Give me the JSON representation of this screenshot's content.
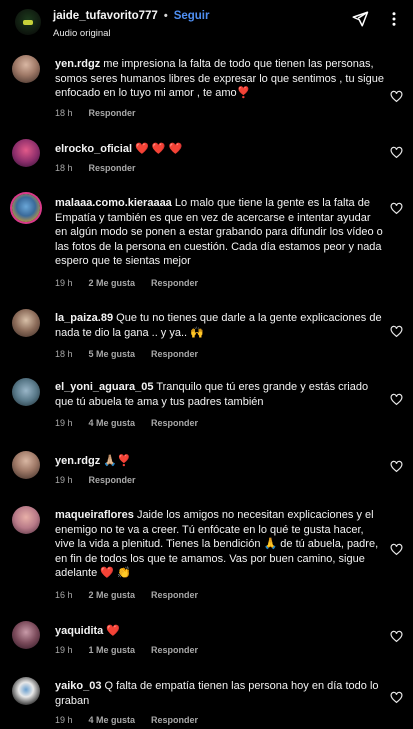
{
  "header": {
    "username": "jaide_tufavorito777",
    "separator": "•",
    "follow_label": "Seguir",
    "audio_label": "Audio original"
  },
  "comments": [
    {
      "username": "yen.rdgz",
      "text": "me impresiona la falta de todo que tienen las personas, somos seres humanos libres de expresar lo que sentimos , tu sigue enfocado en lo tuyo mi amor , te amo❣️",
      "time": "18 h",
      "likes": "",
      "reply": "Responder"
    },
    {
      "username": "elrocko_oficial",
      "text": "❤️ ❤️ ❤️",
      "time": "18 h",
      "likes": "",
      "reply": "Responder"
    },
    {
      "username": "malaaa.como.kieraaaa",
      "text": "Lo malo que tiene la gente es la falta de Empatía y también es que en vez de acercarse e intentar ayudar en algún modo se ponen a estar grabando para difundir los vídeo o las fotos de la persona en cuestión. Cada día estamos peor y nada espero que te sientas mejor",
      "time": "19 h",
      "likes": "2 Me gusta",
      "reply": "Responder"
    },
    {
      "username": "la_paiza.89",
      "text": "Que tu no tienes que darle a la gente explicaciones de nada te dio la gana .. y ya.. 🙌",
      "time": "18 h",
      "likes": "5 Me gusta",
      "reply": "Responder"
    },
    {
      "username": "el_yoni_aguara_05",
      "text": "Tranquilo que tú eres grande y estás criado que tú abuela te ama y tus padres también",
      "time": "19 h",
      "likes": "4 Me gusta",
      "reply": "Responder"
    },
    {
      "username": "yen.rdgz",
      "text": "🙏🏼❣️",
      "time": "19 h",
      "likes": "",
      "reply": "Responder"
    },
    {
      "username": "maqueiraflores",
      "text": "Jaide los amigos no necesitan explicaciones y el enemigo no te va a creer. Tú enfócate en lo qué te gusta hacer, vive la vida a plenitud. Tienes la bendición 🙏 de tú abuela, padre, en fin de todos los que te amamos. Vas por buen camino, sigue adelante ❤️ 👏",
      "time": "16 h",
      "likes": "2 Me gusta",
      "reply": "Responder"
    },
    {
      "username": "yaquidita",
      "text": "❤️",
      "time": "19 h",
      "likes": "1 Me gusta",
      "reply": "Responder"
    },
    {
      "username": "yaiko_03",
      "text": "Q falta de empatía tienen las persona hoy en día todo lo graban",
      "time": "19 h",
      "likes": "4 Me gusta",
      "reply": "Responder"
    }
  ],
  "colors": {
    "background": "#000000",
    "follow": "#4f8ff2",
    "meta": "#a8a8a8"
  },
  "icons": [
    "send-icon",
    "more-icon",
    "heart-outline-icon"
  ]
}
